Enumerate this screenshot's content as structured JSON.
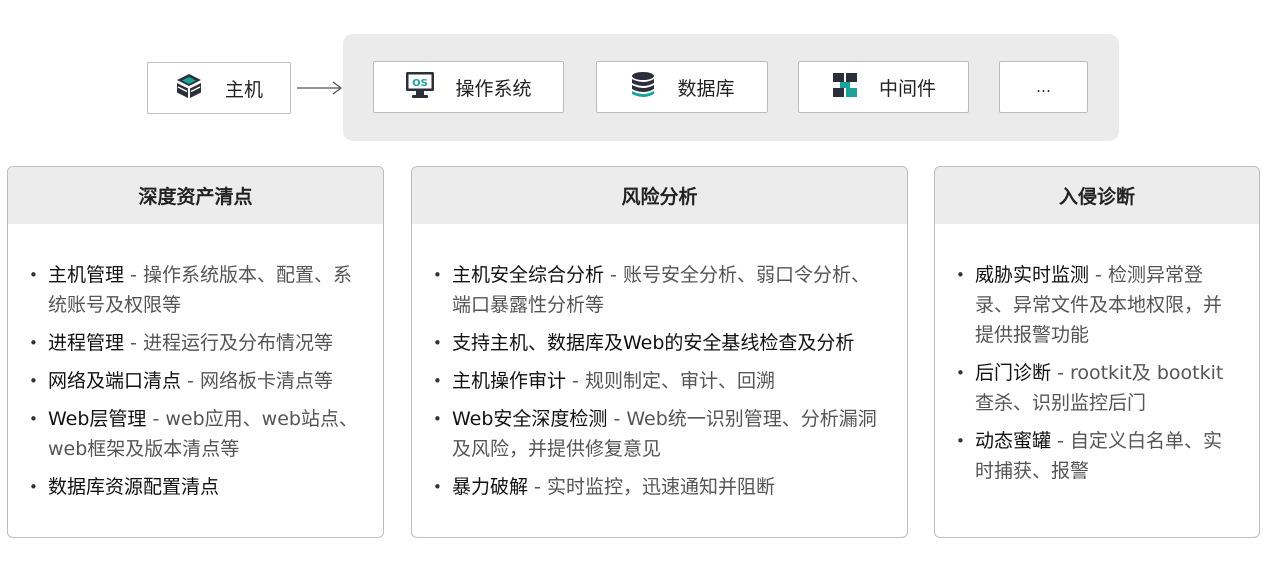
{
  "top": {
    "host": {
      "label": "主机",
      "icon": "server-cube-icon"
    },
    "components": [
      {
        "label": "操作系统",
        "icon": "os-monitor-icon",
        "icon_text": "OS"
      },
      {
        "label": "数据库",
        "icon": "database-icon"
      },
      {
        "label": "中间件",
        "icon": "middleware-icon"
      },
      {
        "label": "…"
      }
    ]
  },
  "panels": [
    {
      "title": "深度资产清点",
      "items": [
        {
          "bold": "主机管理",
          "desc": " - 操作系统版本、配置、系统账号及权限等"
        },
        {
          "bold": "进程管理",
          "desc": " - 进程运行及分布情况等"
        },
        {
          "bold": "网络及端口清点",
          "desc": " - 网络板卡清点等"
        },
        {
          "bold": "Web层管理",
          "desc": " - web应用、web站点、web框架及版本清点等"
        },
        {
          "bold": "数据库资源配置清点",
          "desc": ""
        }
      ]
    },
    {
      "title": "风险分析",
      "items": [
        {
          "bold": "主机安全综合分析",
          "desc": " - 账号安全分析、弱口令分析、端口暴露性分析等"
        },
        {
          "bold": "支持主机、数据库及Web的安全基线检查及分析",
          "desc": ""
        },
        {
          "bold": "主机操作审计",
          "desc": " - 规则制定、审计、回溯"
        },
        {
          "bold": "Web安全深度检测",
          "desc": " - Web统一识别管理、分析漏洞及风险，并提供修复意见"
        },
        {
          "bold": "暴力破解",
          "desc": " - 实时监控，迅速通知并阻断"
        }
      ]
    },
    {
      "title": "入侵诊断",
      "items": [
        {
          "bold": "威胁实时监测",
          "desc": " - 检测异常登录、异常文件及本地权限，并提供报警功能"
        },
        {
          "bold": "后门诊断",
          "desc": " - rootkit及 bootkit查杀、识别监控后门"
        },
        {
          "bold": "动态蜜罐",
          "desc": " - 自定义白名单、实时捕获、报警"
        }
      ]
    }
  ],
  "colors": {
    "panel_header_bg": "#ececec",
    "group_bg": "#ebebeb",
    "border": "#bdbdbd",
    "icon_dark": "#2b2f3a",
    "icon_teal": "#1aa39a"
  }
}
